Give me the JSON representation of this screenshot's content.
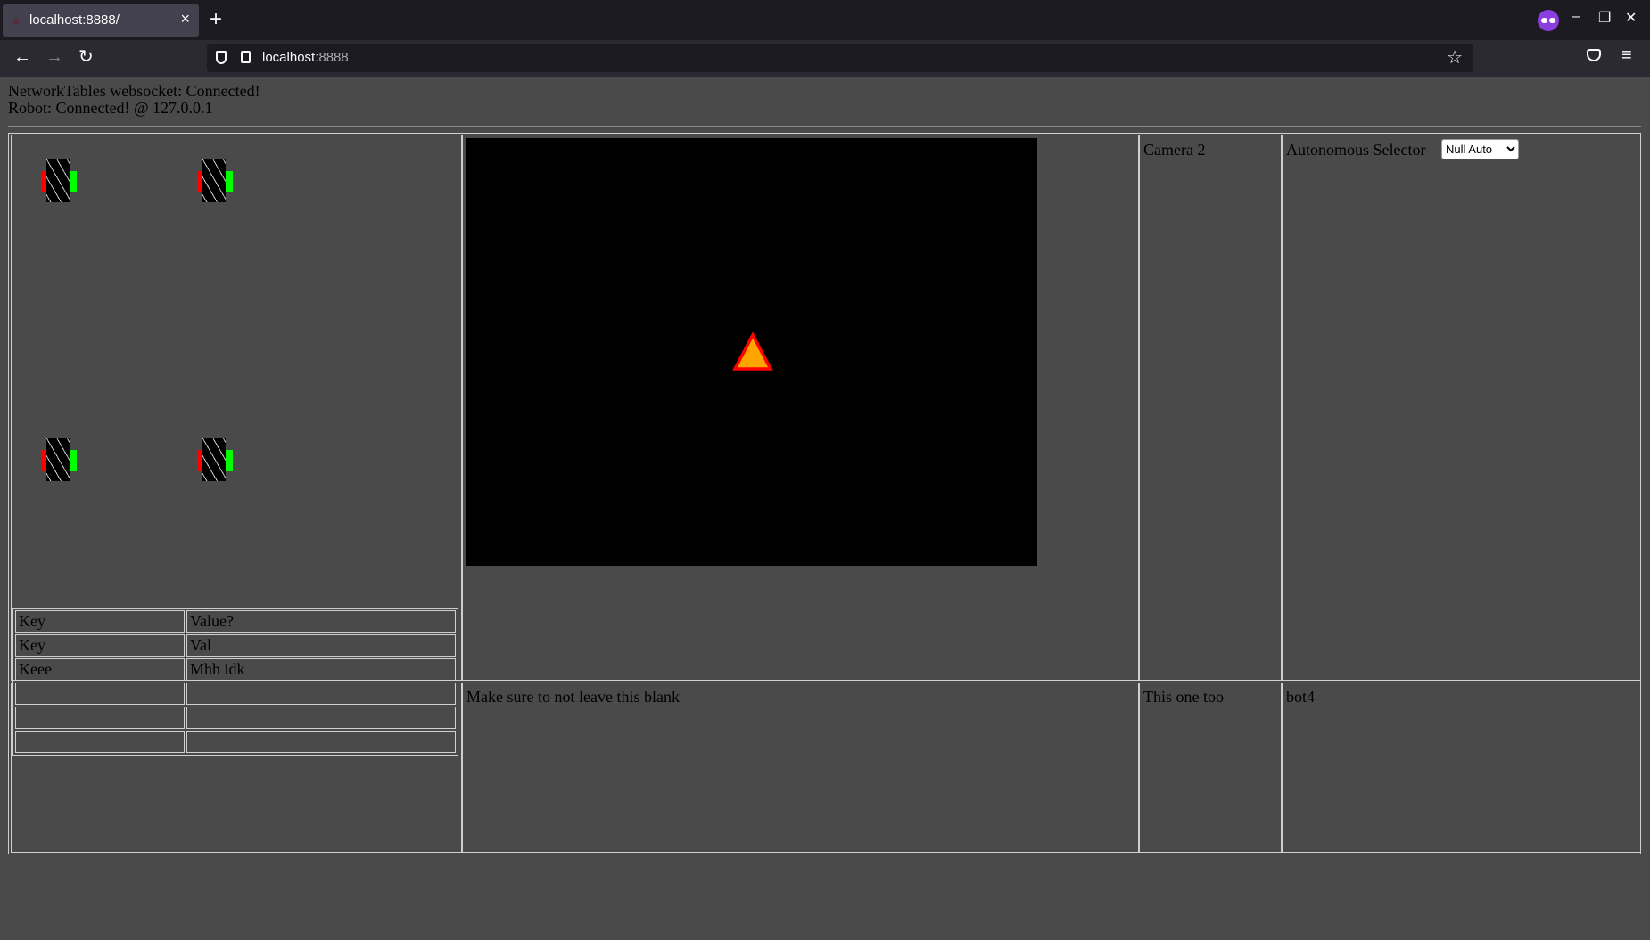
{
  "browser": {
    "tab_title": "localhost:8888/",
    "tab_close": "×",
    "new_tab": "+",
    "url_host": "localhost",
    "url_port": ":8888",
    "back": "←",
    "forward": "→",
    "reload": "↻",
    "bookmark_star": "☆",
    "menu": "≡",
    "minimize": "–",
    "restore": "❐",
    "close": "✕"
  },
  "status": {
    "networktables": "NetworkTables websocket: Connected!",
    "robot": "Robot: Connected! @ 127.0.0.1"
  },
  "camera2_label": "Camera 2",
  "autonomous": {
    "label": "Autonomous Selector",
    "selected": "Null Auto"
  },
  "table": {
    "header": [
      "Key",
      "Value?"
    ],
    "rows": [
      [
        "Key",
        "Val"
      ],
      [
        "Keee",
        "Mhh idk"
      ],
      [
        "",
        ""
      ],
      [
        "",
        ""
      ],
      [
        "",
        ""
      ]
    ]
  },
  "bottom_cells": {
    "middle": "Make sure to not leave this blank",
    "camera2_bottom": "This one too",
    "right": "bot4"
  },
  "colors": {
    "background": "#4a4a4a",
    "module_left": "#ff0000",
    "module_right": "#00ff00",
    "marker_fill": "#ffa500",
    "marker_stroke": "#ff0000"
  }
}
